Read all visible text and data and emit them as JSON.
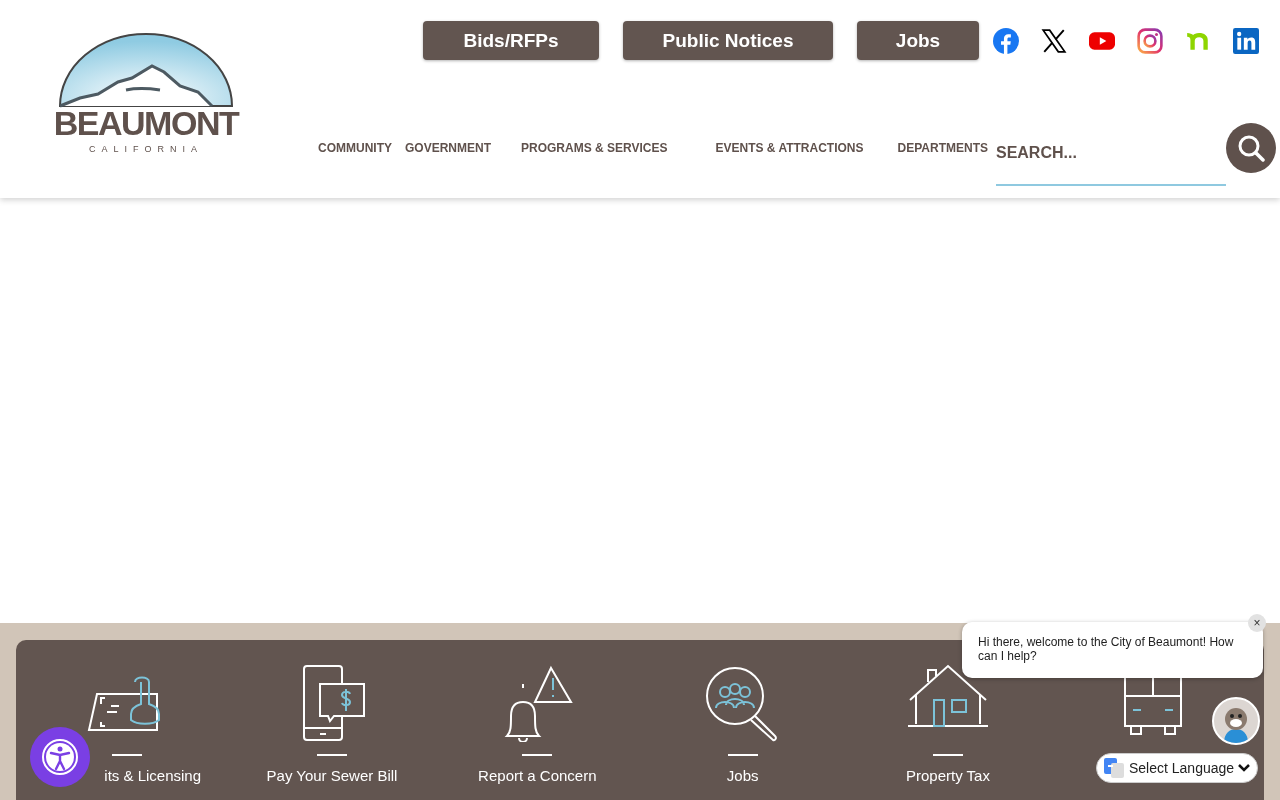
{
  "logo": {
    "name": "BEAUMONT",
    "subtitle": "CALIFORNIA"
  },
  "top_buttons": [
    "Bids/RFPs",
    "Public Notices",
    "Jobs"
  ],
  "social": [
    {
      "kind": "facebook"
    },
    {
      "kind": "x"
    },
    {
      "kind": "youtube"
    },
    {
      "kind": "instagram"
    },
    {
      "kind": "nextdoor"
    },
    {
      "kind": "linkedin"
    }
  ],
  "nav": [
    "COMMUNITY",
    "GOVERNMENT",
    "PROGRAMS & SERVICES",
    "EVENTS & ATTRACTIONS",
    "DEPARTMENTS"
  ],
  "search": {
    "placeholder": "SEARCH..."
  },
  "quick_links": [
    {
      "kind": "stamp",
      "label": "its & Licensing"
    },
    {
      "kind": "phone",
      "label": "Pay Your Sewer Bill"
    },
    {
      "kind": "bell",
      "label": "Report a Concern"
    },
    {
      "kind": "people",
      "label": "Jobs"
    },
    {
      "kind": "house",
      "label": "Property Tax"
    },
    {
      "kind": "bus"
    }
  ],
  "chat": {
    "message": "Hi there, welcome to the City of Beaumont! How can I help?",
    "close": "×"
  },
  "language": {
    "label": "Select Language"
  }
}
